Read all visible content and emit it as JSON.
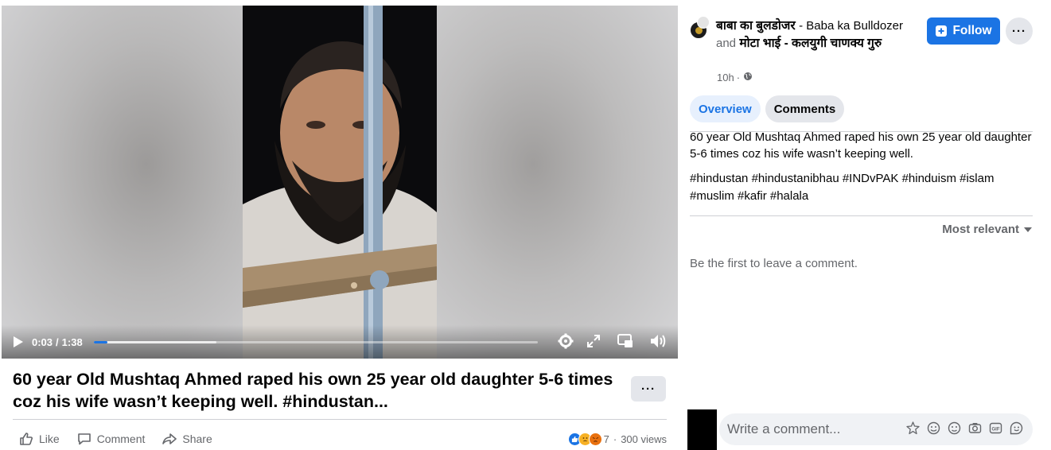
{
  "video": {
    "current_time": "0:03",
    "duration": "1:38",
    "progress": 0.03
  },
  "post": {
    "title": "60 year Old Mushtaq Ahmed raped his own 25 year old daughter 5-6 times coz his wife wasn’t keeping well. #hindustan...",
    "more_label": "···",
    "actions": {
      "like": "Like",
      "comment": "Comment",
      "share": "Share"
    },
    "reaction_count": "7",
    "views": "300 views",
    "separator": "·"
  },
  "side": {
    "author_primary": "बाबा का बुलडोजर",
    "author_primary_sub": "- Baba ka Bulldozer",
    "and_word": "and",
    "author_secondary": "मोटा भाई - कलयुगी चाणक्य गुरु",
    "time": "10h",
    "follow_label": "Follow",
    "more_label": "···",
    "tabs": [
      {
        "label": "Overview",
        "active": true
      },
      {
        "label": "Comments",
        "active": false
      }
    ],
    "description": "60 year Old Mushtaq Ahmed raped his own 25 year old daughter 5-6 times coz his wife wasn’t keeping well.",
    "hashtags": "#hindustan #hindustanibhau #INDvPAK #hinduism #islam #muslim #kafir #halala",
    "sort_label": "Most relevant",
    "empty_comments": "Be the first to leave a comment.",
    "composer_placeholder": "Write a comment..."
  },
  "colors": {
    "accent": "#1b74e4",
    "text_secondary": "#65676b"
  }
}
